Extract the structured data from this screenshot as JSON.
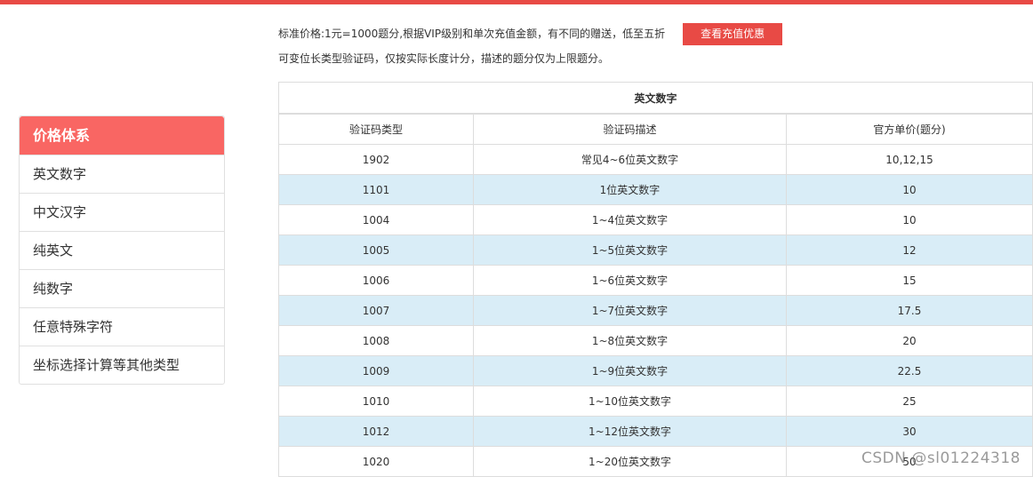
{
  "colors": {
    "accent": "#e84a45",
    "sidebar_header": "#f96663",
    "row_highlight": "#d9edf7"
  },
  "intro": {
    "line1": "标准价格:1元=1000题分,根据VIP级别和单次充值金额，有不同的赠送，低至五折",
    "line2": "可变位长类型验证码，仅按实际长度计分，描述的题分仅为上限题分。",
    "recharge_button": "查看充值优惠"
  },
  "sidebar": {
    "header": "价格体系",
    "items": [
      {
        "label": "英文数字"
      },
      {
        "label": "中文汉字"
      },
      {
        "label": "纯英文"
      },
      {
        "label": "纯数字"
      },
      {
        "label": "任意特殊字符"
      },
      {
        "label": "坐标选择计算等其他类型"
      }
    ]
  },
  "table": {
    "caption": "英文数字",
    "columns": [
      "验证码类型",
      "验证码描述",
      "官方单价(题分)"
    ],
    "rows": [
      {
        "type": "1902",
        "desc": "常见4~6位英文数字",
        "price": "10,12,15"
      },
      {
        "type": "1101",
        "desc": "1位英文数字",
        "price": "10"
      },
      {
        "type": "1004",
        "desc": "1~4位英文数字",
        "price": "10"
      },
      {
        "type": "1005",
        "desc": "1~5位英文数字",
        "price": "12"
      },
      {
        "type": "1006",
        "desc": "1~6位英文数字",
        "price": "15"
      },
      {
        "type": "1007",
        "desc": "1~7位英文数字",
        "price": "17.5"
      },
      {
        "type": "1008",
        "desc": "1~8位英文数字",
        "price": "20"
      },
      {
        "type": "1009",
        "desc": "1~9位英文数字",
        "price": "22.5"
      },
      {
        "type": "1010",
        "desc": "1~10位英文数字",
        "price": "25"
      },
      {
        "type": "1012",
        "desc": "1~12位英文数字",
        "price": "30"
      },
      {
        "type": "1020",
        "desc": "1~20位英文数字",
        "price": "50"
      }
    ]
  },
  "watermark": "CSDN @sl01224318"
}
